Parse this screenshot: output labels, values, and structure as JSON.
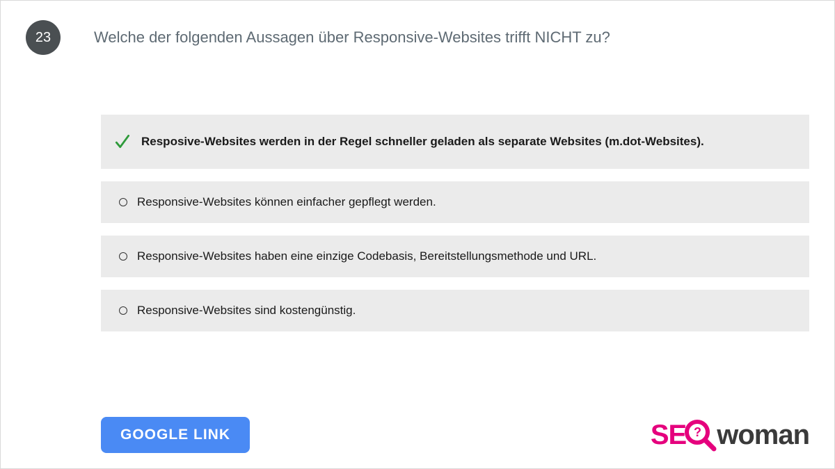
{
  "question": {
    "number": "23",
    "text": "Welche der folgenden Aussagen über Responsive-Websites trifft NICHT zu?"
  },
  "answers": [
    {
      "text": "Resposive-Websites werden in der Regel schneller geladen als separate Websites (m.dot-Websites).",
      "correct": true
    },
    {
      "text": "Responsive-Websites können einfacher gepflegt werden.",
      "correct": false
    },
    {
      "text": "Responsive-Websites haben eine einzige Codebasis, Bereitstellungsmethode und URL.",
      "correct": false
    },
    {
      "text": "Responsive-Websites sind kostengünstig.",
      "correct": false
    }
  ],
  "footer": {
    "button_label": "GOOGLE   LINK"
  },
  "logo": {
    "part1": "SE",
    "part2": "woman"
  },
  "colors": {
    "accent_pink": "#e5007d",
    "button_blue": "#4a8af4",
    "answer_bg": "#ebebeb",
    "check_green": "#2e9a3a"
  }
}
